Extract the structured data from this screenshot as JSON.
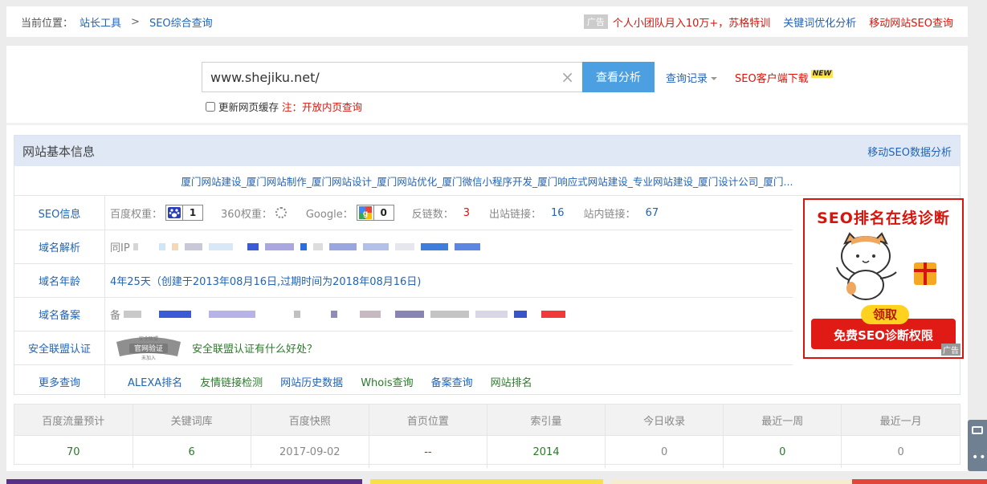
{
  "breadcrumb": {
    "label": "当前位置：",
    "items": [
      "站长工具",
      "SEO综合查询"
    ],
    "sep": ">"
  },
  "top_links": {
    "ad_tag": "广告",
    "promo": "个人小团队月入10万+，苏格特训",
    "keyword": "关键词优化分析",
    "mobile": "移动网站SEO查询"
  },
  "search": {
    "value": "www.shejiku.net/",
    "clear": "×",
    "button": "查看分析",
    "history": "查询记录",
    "client": "SEO客户端下载",
    "new_badge": "NEW",
    "cache_label": "更新网页缓存",
    "cache_note": "注：开放内页查询"
  },
  "info": {
    "title": "网站基本信息",
    "mobile_link": "移动SEO数据分析",
    "site_title": "厦门网站建设_厦门网站制作_厦门网站设计_厦门网站优化_厦门微信小程序开发_厦门响应式网站建设_专业网站建设_厦门设计公司_厦门..."
  },
  "seo": {
    "label": "SEO信息",
    "baidu_k": "百度权重：",
    "baidu_v": "1",
    "r360_k": "360权重：",
    "google_k": "Google：",
    "google_v": "0",
    "backlinks_k": "反链数：",
    "backlinks_v": "3",
    "outlinks_k": "出站链接：",
    "outlinks_v": "16",
    "inlinks_k": "站内链接：",
    "inlinks_v": "67"
  },
  "dns": {
    "label": "域名解析",
    "prefix": "同IP"
  },
  "age": {
    "label": "域名年龄",
    "value": "4年25天（创建于2013年08月16日,过期时间为2018年08月16日)"
  },
  "icp": {
    "label": "域名备案",
    "prefix": "备"
  },
  "security": {
    "label": "安全联盟认证",
    "link": "安全联盟认证有什么好处？",
    "stamp_top": "安全联盟",
    "stamp_main": "官网验证",
    "stamp_sub": "未加入"
  },
  "more": {
    "label": "更多查询",
    "links": [
      "ALEXA排名",
      "友情链接检测",
      "网站历史数据",
      "Whois查询",
      "备案查询",
      "网站排名"
    ]
  },
  "ad": {
    "title": "SEO排名在线诊断",
    "get": "领取",
    "free": "免费SEO诊断权限",
    "mark": "广告"
  },
  "stats": {
    "headers": [
      "百度流量预计",
      "关键词库",
      "百度快照",
      "首页位置",
      "索引量",
      "今日收录",
      "最近一周",
      "最近一月"
    ],
    "values": [
      "70",
      "6",
      "2017-09-02",
      "--",
      "2014",
      "0",
      "0",
      "0"
    ]
  },
  "colors": {
    "accent": "#2164b8",
    "red": "#d8150c",
    "button": "#4c9fe0",
    "green": "#2a7a2a"
  }
}
